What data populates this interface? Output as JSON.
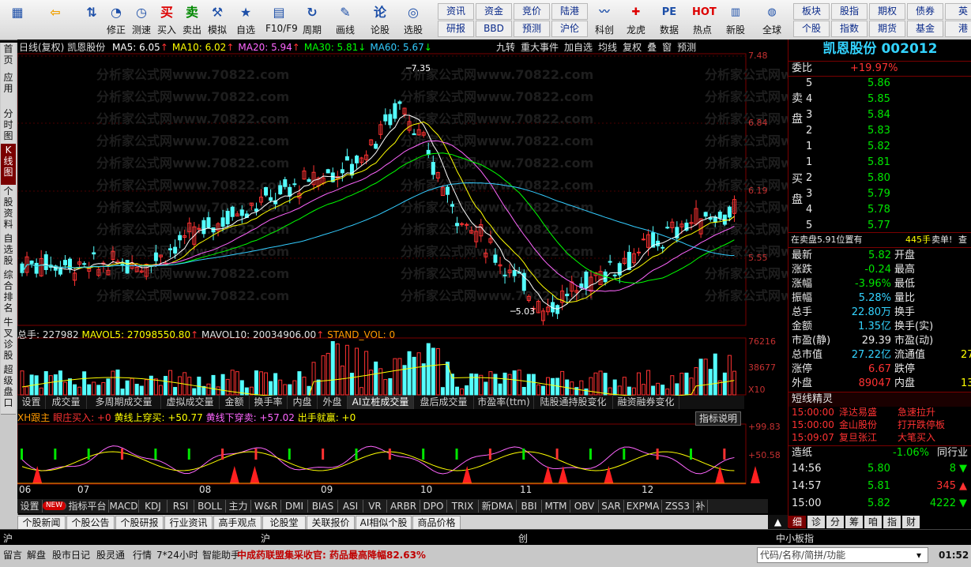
{
  "toolbar": {
    "left_buttons": [
      {
        "label": "",
        "icon": "grid-icon"
      },
      {
        "label": "",
        "icon": "back-arrow-icon"
      },
      {
        "label": "",
        "icon": "up-down-arrows-icon"
      },
      {
        "label": "修正",
        "icon": "revision-icon"
      },
      {
        "label": "测速",
        "icon": "speed-test-icon"
      },
      {
        "label": "买入",
        "icon": "buy-icon"
      },
      {
        "label": "卖出",
        "icon": "sell-icon"
      },
      {
        "label": "模拟",
        "icon": "hammer-icon"
      },
      {
        "label": "自选",
        "icon": "favorite-icon"
      },
      {
        "label": "F10/F9",
        "icon": "f10-icon"
      },
      {
        "label": "周期",
        "icon": "period-icon"
      },
      {
        "label": "画线",
        "icon": "draw-line-icon"
      },
      {
        "label": "论股",
        "icon": "discuss-icon"
      },
      {
        "label": "选股",
        "icon": "stock-select-icon"
      }
    ],
    "links_top": [
      "资讯",
      "资金",
      "竞价",
      "陆港"
    ],
    "links_bottom": [
      "研报",
      "BBD",
      "预测",
      "沪伦"
    ],
    "right_buttons": [
      {
        "label": "科创",
        "icon": "star-board-icon"
      },
      {
        "label": "龙虎",
        "icon": "dragon-tiger-icon"
      },
      {
        "label": "数据",
        "icon": "data-icon"
      },
      {
        "label": "热点",
        "icon": "hot-icon"
      },
      {
        "label": "新股",
        "icon": "new-stock-icon"
      },
      {
        "label": "全球",
        "icon": "globe-icon"
      }
    ],
    "links_right_top": [
      "板块",
      "股指",
      "期权",
      "债券",
      "英"
    ],
    "links_right_bottom": [
      "个股",
      "指数",
      "期货",
      "基金",
      "港"
    ]
  },
  "left_tabs": [
    "首页",
    "应用",
    "分时图",
    "K线图",
    "个股资料",
    "自选股",
    "综合排名",
    "牛叉诊股",
    "超级盘口"
  ],
  "chart": {
    "title_line": {
      "period": "日线(复权)",
      "name": "凯恩股份",
      "ma": [
        {
          "label": "MA5: 6.05",
          "color": "#ffffff"
        },
        {
          "label": "MA10: 6.02",
          "color": "#ffff00"
        },
        {
          "label": "MA20: 5.94",
          "color": "#ff66ff"
        },
        {
          "label": "MA30: 5.81",
          "color": "#00ff00"
        },
        {
          "label": "MA60: 5.67",
          "color": "#33ccff"
        }
      ],
      "right_actions": [
        "九转",
        "重大事件",
        "加自选",
        "均线",
        "复权",
        "叠",
        "窗",
        "预测"
      ]
    },
    "price_axis": [
      "7.48",
      "6.84",
      "6.19",
      "5.55"
    ],
    "price_high_label": "7.35",
    "price_low_label": "5.03",
    "watermark": "分析家公式网www.70822.com",
    "volume_line": {
      "total": "总手: 227982",
      "mavol5": "MAVOL5: 27098550.80",
      "mavol10": "MAVOL10: 20034906.00",
      "stand": "STAND_VOL: 0"
    },
    "volume_axis": [
      "76216",
      "38677",
      "X10"
    ],
    "indicator_tabs": [
      "设置",
      "成交量",
      "多周期成交量",
      "虚拟成交量",
      "金额",
      "换手率",
      "内盘",
      "外盘",
      "AI立桩成交量",
      "盘后成交量",
      "市盈率(ttm)",
      "陆股通持股变化",
      "融资融券变化"
    ],
    "indicator_line": {
      "name": "XH跟主",
      "a": "眼庄买入: +0",
      "b": "黄线上穿买: +50.77",
      "c": "黄线下穿卖: +57.02",
      "d": "出手就赢: +0",
      "help": "指标说明"
    },
    "indicator_axis": [
      "+99.83",
      "+50.58"
    ],
    "date_labels": [
      "06",
      "07",
      "08",
      "09",
      "10",
      "11",
      "12"
    ]
  },
  "bottom_tabs": [
    "设置",
    "NEW",
    "指标平台",
    "MACD",
    "KDJ",
    "RSI",
    "BOLL",
    "主力",
    "W&R",
    "DMI",
    "BIAS",
    "ASI",
    "VR",
    "ARBR",
    "DPO",
    "TRIX",
    "新DMA",
    "BBI",
    "MTM",
    "OBV",
    "SAR",
    "EXPMA",
    "ZSS3",
    "补"
  ],
  "news_tabs": [
    "个股新闻",
    "个股公告",
    "个股研报",
    "行业资讯",
    "高手观点",
    "论股堂",
    "关联报价",
    "AI相似个股",
    "商品价格"
  ],
  "right_panel": {
    "title": "凯恩股份 002012",
    "wei_bi_label": "委比",
    "wei_bi": "+19.97%",
    "sell_label": "卖盘",
    "buy_label": "买盘",
    "asks": [
      {
        "lvl": "5",
        "price": "5.86"
      },
      {
        "lvl": "4",
        "price": "5.85"
      },
      {
        "lvl": "3",
        "price": "5.84"
      },
      {
        "lvl": "2",
        "price": "5.83"
      },
      {
        "lvl": "1",
        "price": "5.82"
      }
    ],
    "bids": [
      {
        "lvl": "1",
        "price": "5.81"
      },
      {
        "lvl": "2",
        "price": "5.80"
      },
      {
        "lvl": "3",
        "price": "5.79"
      },
      {
        "lvl": "4",
        "price": "5.78"
      },
      {
        "lvl": "5",
        "price": "5.77"
      }
    ],
    "notice": {
      "a": "在卖盘5.91位置有",
      "b": "445手",
      "c": "卖单!",
      "d": "查"
    },
    "quote_rows": [
      {
        "l": "最新",
        "v": "5.82",
        "vc": "grn",
        "r": "开盘"
      },
      {
        "l": "涨跌",
        "v": "-0.24",
        "vc": "grn",
        "r": "最高"
      },
      {
        "l": "涨幅",
        "v": "-3.96%",
        "vc": "grn",
        "r": "最低"
      },
      {
        "l": "振幅",
        "v": "5.28%",
        "vc": "cyan",
        "r": "量比"
      },
      {
        "l": "总手",
        "v": "22.80万",
        "vc": "cyan",
        "r": "换手"
      },
      {
        "l": "金额",
        "v": "1.35亿",
        "vc": "cyan",
        "r": "换手(实)"
      },
      {
        "l": "市盈(静)",
        "v": "29.39",
        "vc": "wht",
        "r": "市盈(动)"
      },
      {
        "l": "总市值",
        "v": "27.22亿",
        "vc": "cyan",
        "r": "流通值"
      },
      {
        "l": "涨停",
        "v": "6.67",
        "vc": "red",
        "r": "跌停"
      },
      {
        "l": "外盘",
        "v": "89047",
        "vc": "red",
        "r": "内盘"
      }
    ],
    "quote_row_tail": [
      "",
      "",
      "",
      "",
      "",
      "",
      "",
      "27",
      "",
      "13"
    ],
    "spirit_title": "短线精灵",
    "spirit_rows": [
      {
        "time": "15:00:00",
        "name": "泽达易盛",
        "event": "急速拉升"
      },
      {
        "time": "15:00:00",
        "name": "金山股份",
        "event": "打开跌停板"
      },
      {
        "time": "15:09:07",
        "name": "复旦张江",
        "event": "大笔买入"
      }
    ],
    "index_row": {
      "name": "造纸",
      "chg": "-1.06%",
      "link": "同行业"
    },
    "ticks": [
      {
        "time": "14:56",
        "price": "5.80",
        "vol": "8",
        "dir": "down"
      },
      {
        "time": "14:57",
        "price": "5.81",
        "vol": "345",
        "dir": "up"
      },
      {
        "time": "15:00",
        "price": "5.82",
        "vol": "4222",
        "dir": "down"
      }
    ],
    "bottom_tabs": [
      "细",
      "诊",
      "分",
      "筹",
      "咱",
      "指",
      "财"
    ]
  },
  "status": {
    "a": "沪",
    "b": "创",
    "c": "中小板指"
  },
  "footer": {
    "items": [
      "留言",
      "解盘",
      "股市日记",
      "股灵通",
      "行情",
      "7*24小时",
      "智能助手"
    ],
    "ticker": "中成药联盟集采收官: 药品最高降幅82.63%",
    "search_placeholder": "代码/名称/简拼/功能",
    "clock": "01:52"
  }
}
